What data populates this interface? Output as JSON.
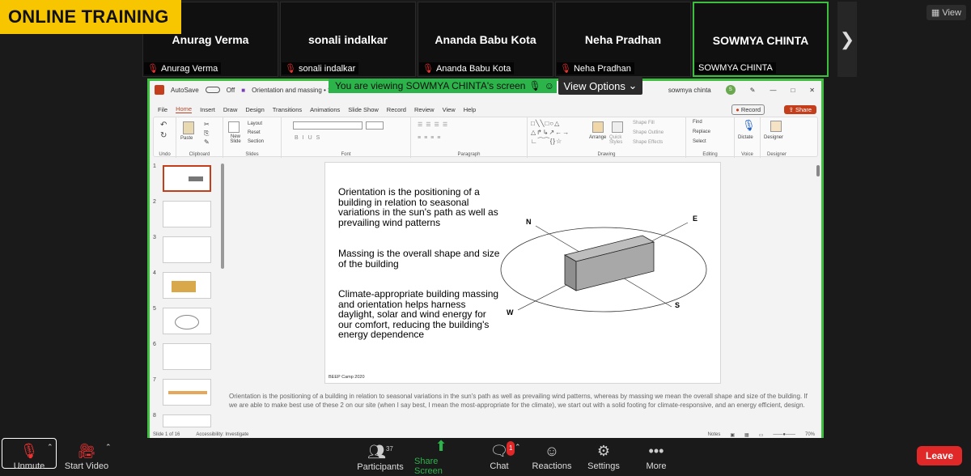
{
  "banner": {
    "label": "ONLINE TRAINING"
  },
  "view_button": {
    "label": "View"
  },
  "participants_strip": [
    {
      "name": "Anurag Verma",
      "tag": "Anurag Verma",
      "muted": true
    },
    {
      "name": "sonali indalkar",
      "tag": "sonali indalkar",
      "muted": true
    },
    {
      "name": "Ananda Babu Kota",
      "tag": "Ananda Babu Kota",
      "muted": true
    },
    {
      "name": "Neha Pradhan",
      "tag": "Neha Pradhan",
      "muted": true
    },
    {
      "name": "SOWMYA CHINTA",
      "tag": "SOWMYA CHINTA",
      "muted": false
    }
  ],
  "share_banner": {
    "text": "You are viewing SOWMYA CHINTA's screen",
    "options": "View Options"
  },
  "ppt": {
    "title_bar": {
      "autosave": "AutoSave",
      "toggle": "Off",
      "doc": "Orientation and massing • Saved to this",
      "user": "sowmya chinta"
    },
    "menu": [
      "File",
      "Home",
      "Insert",
      "Draw",
      "Design",
      "Transitions",
      "Animations",
      "Slide Show",
      "Record",
      "Review",
      "View",
      "Help"
    ],
    "record_label": "Record",
    "share_label": "Share",
    "ribbon_groups": [
      "Undo",
      "Clipboard",
      "Slides",
      "Font",
      "Paragraph",
      "Drawing",
      "Editing",
      "Voice",
      "Designer"
    ],
    "ribbon_items": {
      "paste": "Paste",
      "new_slide": "New Slide",
      "layout": "Layout",
      "reset": "Reset",
      "section": "Section",
      "arrange": "Arrange",
      "quick_styles": "Quick Styles",
      "shape_fill": "Shape Fill",
      "shape_outline": "Shape Outline",
      "shape_effects": "Shape Effects",
      "find": "Find",
      "replace": "Replace",
      "select": "Select",
      "dictate": "Dictate",
      "designer": "Designer"
    },
    "thumbnail_numbers": [
      "1",
      "2",
      "3",
      "4",
      "5",
      "6",
      "7",
      "8"
    ],
    "slide": {
      "para1": "Orientation is the positioning of a building in relation to seasonal variations in the sun's path as well as prevailing wind patterns",
      "para2": "Massing is the overall shape and size of the building",
      "para3": "Climate-appropriate building massing and orientation helps harness daylight, solar and wind energy for our comfort, reducing the building's energy dependence",
      "footer": "BEEP Camp 2020",
      "compass": {
        "n": "N",
        "e": "E",
        "s": "S",
        "w": "W"
      }
    },
    "notes": "Orientation is the positioning of a building in relation to seasonal variations in the sun's path as well as prevailing wind patterns, whereas by massing we mean the overall shape and size of the building. If we are able to make best use of these 2 on our site (when I say best, I mean the most-appropriate for the climate), we start out with a solid footing for climate-responsive, and an energy efficient, design.",
    "status": {
      "slide": "Slide 1 of 16",
      "accessibility": "Accessibility: Investigate",
      "notes": "Notes",
      "zoom": "70%"
    }
  },
  "toolbar": {
    "unmute": "Unmute",
    "start_video": "Start Video",
    "participants": "Participants",
    "participants_count": "37",
    "share_screen": "Share Screen",
    "chat": "Chat",
    "chat_badge": "1",
    "reactions": "Reactions",
    "settings": "Settings",
    "more": "More",
    "leave": "Leave"
  }
}
